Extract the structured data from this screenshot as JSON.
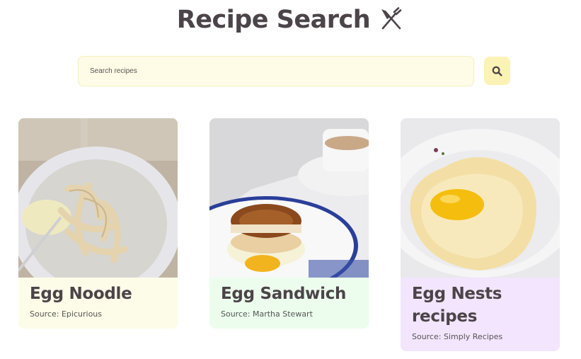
{
  "header": {
    "title": "Recipe Search",
    "icon": "utensils-icon"
  },
  "search": {
    "placeholder": "Search recipes",
    "value": "",
    "button_icon": "search-icon"
  },
  "colors": {
    "title_text": "#4b4448",
    "search_bg": "#fefce6",
    "search_button_bg": "#fbf2b5",
    "card_1_bg": "#fdfce8",
    "card_2_bg": "#ecfded",
    "card_3_bg": "#f2e5fd"
  },
  "recipes": [
    {
      "title": "Egg Noodle",
      "source": "Source: Epicurious",
      "image": "egg-noodle-photo"
    },
    {
      "title": "Egg Sandwich",
      "source": "Source: Martha Stewart",
      "image": "egg-sandwich-photo"
    },
    {
      "title": "Egg Nests recipes",
      "source": "Source: Simply Recipes",
      "image": "egg-nests-photo"
    }
  ]
}
